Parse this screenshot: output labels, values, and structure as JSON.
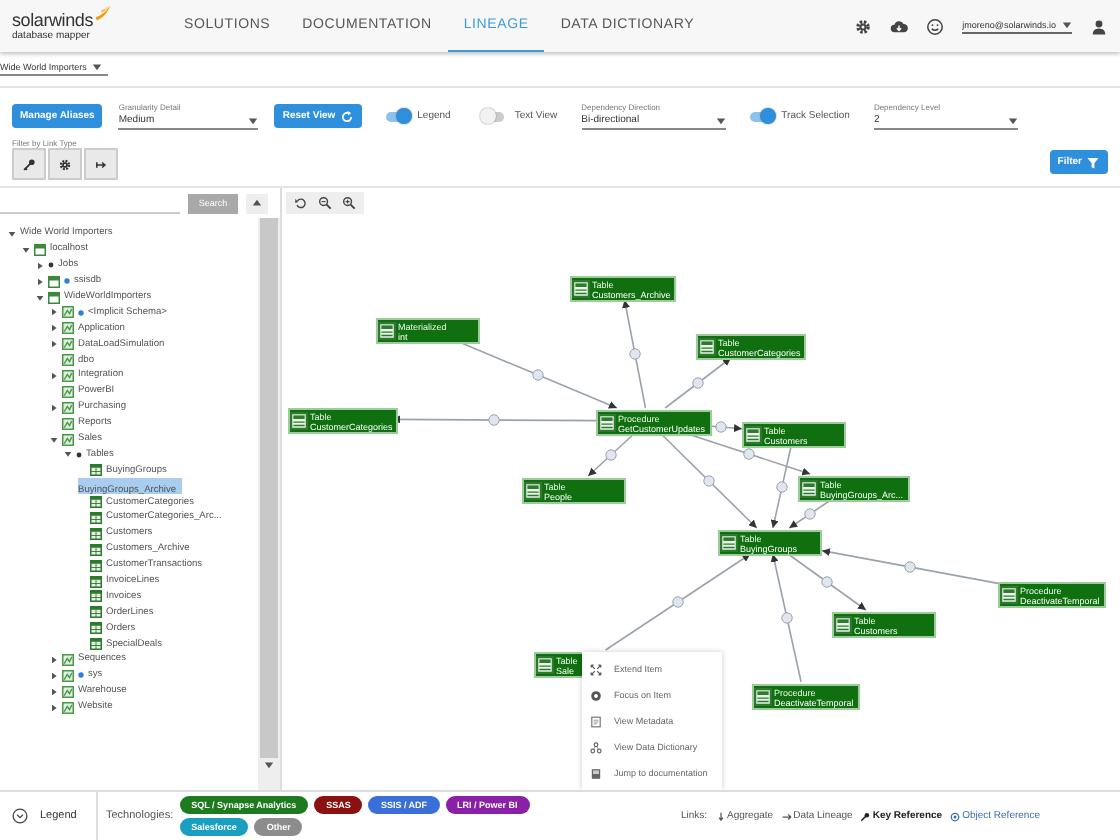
{
  "header": {
    "logo": "solarwinds",
    "logo_sub": "database mapper",
    "user": "jmoreno@solarwinds.io",
    "nav": [
      {
        "label": "SOLUTIONS",
        "selected": false
      },
      {
        "label": "DOCUMENTATION",
        "selected": false
      },
      {
        "label": "LINEAGE",
        "selected": true
      },
      {
        "label": "DATA DICTIONARY",
        "selected": false
      }
    ]
  },
  "project": {
    "value": "Wide World Importers"
  },
  "toolbar": {
    "manage_aliases": "Manage Aliases",
    "granularity": {
      "label": "Granularity Detail",
      "value": "Medium"
    },
    "reset": "Reset View",
    "legend_toggle": {
      "label": "Legend",
      "on": true
    },
    "text_view": {
      "label": "Text View",
      "on": false
    },
    "direction": {
      "label": "Dependency Direction",
      "value": "Bi-directional"
    },
    "track": {
      "label": "Track Selection",
      "on": true
    },
    "level": {
      "label": "Dependency Level",
      "value": "2"
    },
    "filter_by": "Filter by Link Type",
    "filter": "Filter"
  },
  "tree": {
    "search_button": "Search",
    "items": [
      {
        "label": "Wide World Importers",
        "kind": "root",
        "expanded": true,
        "selected": false,
        "children": [
          {
            "label": "localhost",
            "kind": "database",
            "expanded": true,
            "selected": false,
            "children": [
              {
                "label": "Jobs",
                "kind": "folder",
                "expanded": false,
                "selected": false
              },
              {
                "label": "ssisdb",
                "kind": "linkeddatabase",
                "expanded": false,
                "selected": false
              },
              {
                "label": "WideWorldImporters",
                "kind": "database",
                "expanded": true,
                "selected": false,
                "children": [
                  {
                    "label": "<Implicit Schema>",
                    "kind": "linkedschema",
                    "expanded": false,
                    "selected": false
                  },
                  {
                    "label": "Application",
                    "kind": "schema",
                    "expanded": false,
                    "selected": false
                  },
                  {
                    "label": "DataLoadSimulation",
                    "kind": "schema",
                    "expanded": false,
                    "selected": false
                  },
                  {
                    "label": "dbo",
                    "kind": "schema",
                    "selected": false
                  },
                  {
                    "label": "Integration",
                    "kind": "schema",
                    "expanded": false,
                    "selected": false
                  },
                  {
                    "label": "PowerBI",
                    "kind": "schema",
                    "selected": false
                  },
                  {
                    "label": "Purchasing",
                    "kind": "schema",
                    "expanded": false,
                    "selected": false
                  },
                  {
                    "label": "Reports",
                    "kind": "schema",
                    "selected": false
                  },
                  {
                    "label": "Sales",
                    "kind": "schema",
                    "expanded": true,
                    "selected": false,
                    "children": [
                      {
                        "label": "Tables",
                        "kind": "folder",
                        "expanded": true,
                        "selected": false,
                        "children": [
                          {
                            "label": "BuyingGroups",
                            "kind": "table",
                            "selected": false
                          },
                          {
                            "label": "BuyingGroups_Archive",
                            "kind": "table",
                            "selected": true
                          },
                          {
                            "label": "CustomerCategories",
                            "kind": "table",
                            "selected": false
                          },
                          {
                            "label": "CustomerCategories_Arc...",
                            "kind": "table",
                            "selected": false
                          },
                          {
                            "label": "Customers",
                            "kind": "table",
                            "selected": false
                          },
                          {
                            "label": "Customers_Archive",
                            "kind": "table",
                            "selected": false
                          },
                          {
                            "label": "CustomerTransactions",
                            "kind": "table",
                            "selected": false
                          },
                          {
                            "label": "InvoiceLines",
                            "kind": "table",
                            "selected": false
                          },
                          {
                            "label": "Invoices",
                            "kind": "table",
                            "selected": false
                          },
                          {
                            "label": "OrderLines",
                            "kind": "table",
                            "selected": false
                          },
                          {
                            "label": "Orders",
                            "kind": "table",
                            "selected": false
                          },
                          {
                            "label": "SpecialDeals",
                            "kind": "table",
                            "selected": false
                          }
                        ]
                      }
                    ]
                  },
                  {
                    "label": "Sequences",
                    "kind": "schema",
                    "expanded": false,
                    "selected": false
                  },
                  {
                    "label": "sys",
                    "kind": "linkedschema",
                    "expanded": false,
                    "selected": false
                  },
                  {
                    "label": "Warehouse",
                    "kind": "schema",
                    "expanded": false,
                    "selected": false
                  },
                  {
                    "label": "Website",
                    "kind": "schema",
                    "expanded": false,
                    "selected": false
                  }
                ]
              }
            ]
          }
        ]
      }
    ]
  },
  "graph": {
    "nodes": [
      {
        "type": "Table",
        "name": "Customers_Archive"
      },
      {
        "type": "Materialized",
        "name": "int"
      },
      {
        "type": "Table",
        "name": "CustomerCategories"
      },
      {
        "type": "Table",
        "name": "CustomerCategories"
      },
      {
        "type": "Procedure",
        "name": "GetCustomerUpdates"
      },
      {
        "type": "Table",
        "name": "Customers"
      },
      {
        "type": "Table",
        "name": "People"
      },
      {
        "type": "Table",
        "name": "BuyingGroups_Arc..."
      },
      {
        "type": "Table",
        "name": "BuyingGroups"
      },
      {
        "type": "Procedure",
        "name": "DeactivateTemporal"
      },
      {
        "type": "Table",
        "name": "Customers"
      },
      {
        "type": "Procedure",
        "name": "DeactivateTemporal"
      },
      {
        "type": "Table",
        "name": "Sale"
      }
    ]
  },
  "context_menu": {
    "items": [
      {
        "label": "Extend Item",
        "kind": "expand"
      },
      {
        "label": "Focus on Item",
        "kind": "target"
      },
      {
        "label": "View Metadata",
        "kind": "doc"
      },
      {
        "label": "View Data Dictionary",
        "kind": "network"
      },
      {
        "label": "Jump to documentation",
        "kind": "book"
      }
    ]
  },
  "legend": {
    "label": "Legend",
    "technologies_label": "Technologies:",
    "technologies": [
      {
        "label": "SQL / Synapse Analytics",
        "color": "#1e7a1e"
      },
      {
        "label": "SSAS",
        "color": "#8b1010"
      },
      {
        "label": "SSIS / ADF",
        "color": "#3b6fd8"
      },
      {
        "label": "LRI / Power BI",
        "color": "#8a1fa8"
      },
      {
        "label": "Salesforce",
        "color": "#1a9fc0"
      },
      {
        "label": "Other",
        "color": "#8c8c8c"
      }
    ],
    "links_label": "Links:",
    "links": [
      {
        "kind": "aggregate",
        "label": "Aggregate"
      },
      {
        "kind": "lineage",
        "label": "Data Lineage"
      },
      {
        "kind": "key",
        "label": "Key Reference"
      },
      {
        "kind": "object",
        "label": "Object Reference"
      }
    ]
  }
}
